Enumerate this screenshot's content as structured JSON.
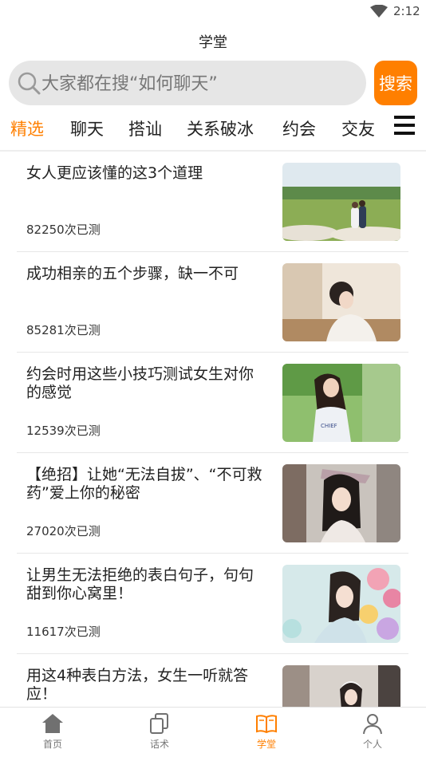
{
  "status_bar": {
    "time": "2:12"
  },
  "header": {
    "title": "学堂"
  },
  "search": {
    "placeholder": "大家都在搜“如何聊天”",
    "button_label": "搜索"
  },
  "tabs": [
    {
      "label": "精选",
      "active": true
    },
    {
      "label": "聊天",
      "active": false
    },
    {
      "label": "搭讪",
      "active": false
    },
    {
      "label": "关系破冰",
      "active": false
    },
    {
      "label": "约会",
      "active": false
    },
    {
      "label": "交友",
      "active": false
    }
  ],
  "articles": [
    {
      "title": "女人更应该懂的这3个道理",
      "count": "82250次已测"
    },
    {
      "title": "成功相亲的五个步骤，缺一不可",
      "count": "85281次已测"
    },
    {
      "title": "约会时用这些小技巧测试女生对你的感觉",
      "count": "12539次已测"
    },
    {
      "title": "【绝招】让她“无法自拔”、“不可救药”爱上你的秘密",
      "count": "27020次已测"
    },
    {
      "title": "让男生无法拒绝的表白句子，句句甜到你心窝里！",
      "count": "11617次已测"
    },
    {
      "title": "用这4种表白方法，女生一听就答应！",
      "count": ""
    }
  ],
  "bottom_nav": [
    {
      "label": "首页",
      "icon": "home-icon",
      "active": false
    },
    {
      "label": "话术",
      "icon": "copy-icon",
      "active": false
    },
    {
      "label": "学堂",
      "icon": "book-icon",
      "active": true
    },
    {
      "label": "个人",
      "icon": "person-icon",
      "active": false
    }
  ],
  "colors": {
    "accent": "#ff7f00",
    "search_bg": "#e6e6e6"
  }
}
